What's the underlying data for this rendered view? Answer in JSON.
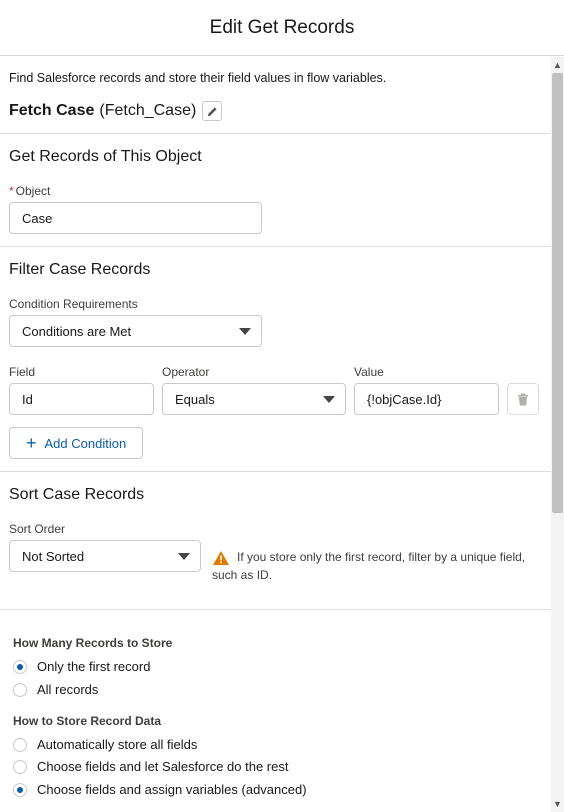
{
  "modal": {
    "title": "Edit Get Records"
  },
  "element": {
    "description": "Find Salesforce records and store their field values in flow variables.",
    "label": "Fetch Case",
    "api_name": "(Fetch_Case)"
  },
  "object_section": {
    "title": "Get Records of This Object",
    "object_label": "Object",
    "required_marker": "*",
    "object_value": "Case"
  },
  "filter_section": {
    "title": "Filter Case Records",
    "condition_label": "Condition Requirements",
    "condition_value": "Conditions are Met",
    "field_label": "Field",
    "operator_label": "Operator",
    "value_label": "Value",
    "row": {
      "field": "Id",
      "operator": "Equals",
      "value": "{!objCase.Id}"
    },
    "add_condition_label": "Add Condition"
  },
  "sort_section": {
    "title": "Sort Case Records",
    "sort_order_label": "Sort Order",
    "sort_order_value": "Not Sorted",
    "warning": "If you store only the first record, filter by a unique field, such as ID."
  },
  "store_section": {
    "how_many_title": "How Many Records to Store",
    "how_many_options": [
      {
        "label": "Only the first record",
        "checked": true
      },
      {
        "label": "All records",
        "checked": false
      }
    ],
    "how_store_title": "How to Store Record Data",
    "how_store_options": [
      {
        "label": "Automatically store all fields",
        "checked": false
      },
      {
        "label": "Choose fields and let Salesforce do the rest",
        "checked": false
      },
      {
        "label": "Choose fields and assign variables (advanced)",
        "checked": true
      }
    ]
  },
  "colors": {
    "accent": "#0b5cab",
    "required": "#c23934",
    "warning": "#dd7a01",
    "border": "#c9c9c9"
  },
  "icons": {
    "edit": "pencil-icon",
    "delete": "trash-icon",
    "add": "plus-icon",
    "warning": "warning-icon"
  }
}
